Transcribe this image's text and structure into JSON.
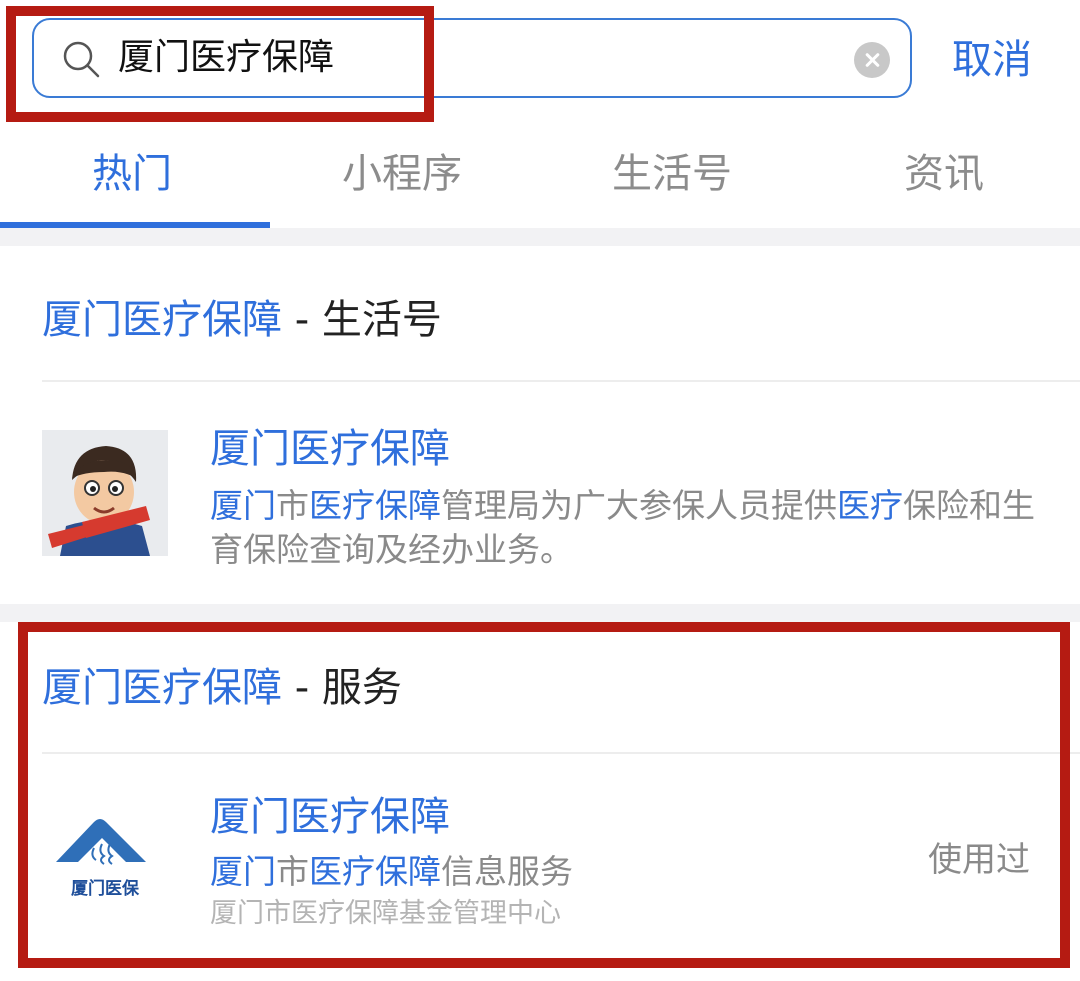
{
  "search": {
    "query": "厦门医疗保障",
    "cancel_label": "取消"
  },
  "tabs": [
    {
      "label": "热门",
      "active": true
    },
    {
      "label": "小程序",
      "active": false
    },
    {
      "label": "生活号",
      "active": false
    },
    {
      "label": "资讯",
      "active": false
    }
  ],
  "life_section": {
    "title_highlight": "厦门医疗保障",
    "title_suffix": " - 生活号",
    "item": {
      "title": "厦门医疗保障",
      "desc_parts": [
        {
          "text": "厦门",
          "hl": true
        },
        {
          "text": "市",
          "hl": false
        },
        {
          "text": "医疗保障",
          "hl": true
        },
        {
          "text": "管理局为广大参保人员提供",
          "hl": false
        },
        {
          "text": "医疗",
          "hl": true
        },
        {
          "text": "保险和生育保险查询及经办业务。",
          "hl": false
        }
      ],
      "avatar_icon": "cartoon-avatar-icon"
    }
  },
  "service_section": {
    "title_highlight": "厦门医疗保障",
    "title_suffix": " - 服务",
    "item": {
      "title": "厦门医疗保障",
      "desc_parts": [
        {
          "text": "厦门",
          "hl": true
        },
        {
          "text": "市",
          "hl": false
        },
        {
          "text": "医疗保障",
          "hl": true
        },
        {
          "text": "信息服务",
          "hl": false
        }
      ],
      "sub": "厦门市医疗保障基金管理中心",
      "badge": "使用过",
      "logo_text": "厦门医保"
    }
  },
  "colors": {
    "accent": "#2f6fdc",
    "highlight_border": "#b51b12",
    "muted": "#8a8a8a"
  }
}
